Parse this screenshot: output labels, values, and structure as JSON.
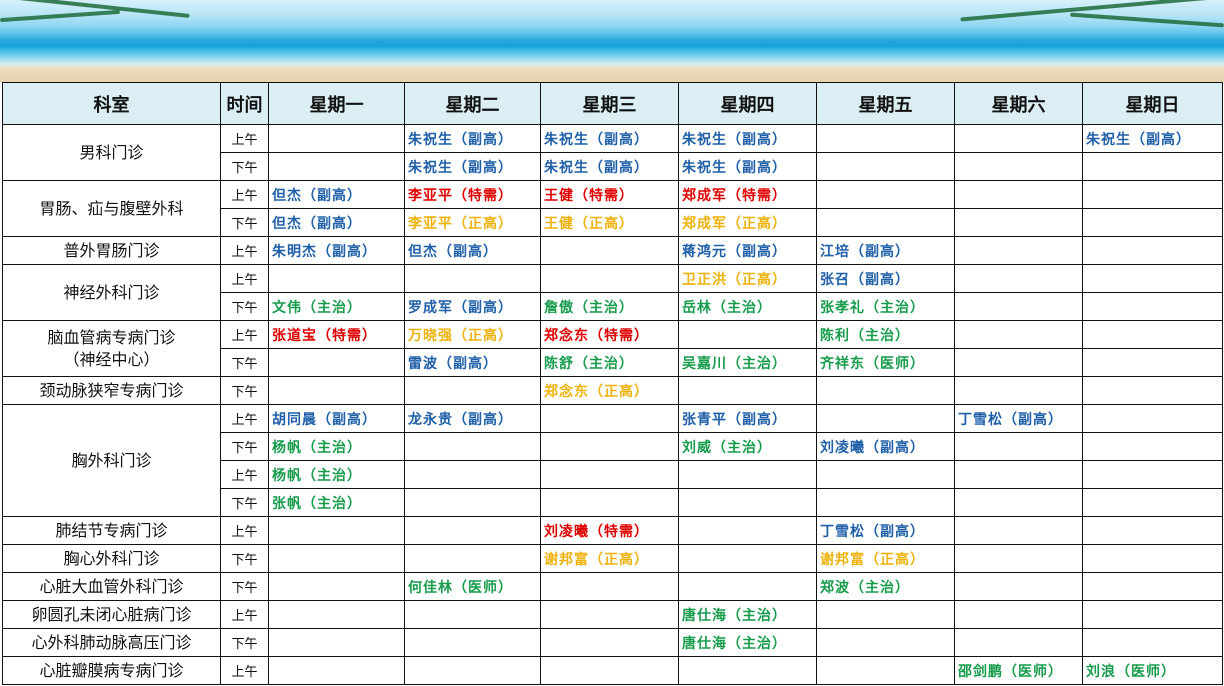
{
  "header": [
    "科室",
    "时间",
    "星期一",
    "星期二",
    "星期三",
    "星期四",
    "星期五",
    "星期六",
    "星期日"
  ],
  "colors": {
    "blue": "#1f5fa8",
    "red": "#e00000",
    "gold": "#eeb20a",
    "green": "#179c4c",
    "header_bg": "#daeef3"
  },
  "departments": [
    {
      "name": "男科门诊",
      "rows": [
        {
          "time": "上午",
          "cells": [
            "",
            {
              "t": "朱祝生（副高）",
              "c": "blue"
            },
            {
              "t": "朱祝生（副高）",
              "c": "blue"
            },
            {
              "t": "朱祝生（副高）",
              "c": "blue"
            },
            "",
            "",
            {
              "t": "朱祝生（副高）",
              "c": "blue"
            }
          ]
        },
        {
          "time": "下午",
          "cells": [
            "",
            {
              "t": "朱祝生（副高）",
              "c": "blue"
            },
            {
              "t": "朱祝生（副高）",
              "c": "blue"
            },
            {
              "t": "朱祝生（副高）",
              "c": "blue"
            },
            "",
            "",
            ""
          ]
        }
      ]
    },
    {
      "name": "胃肠、疝与腹壁外科",
      "rows": [
        {
          "time": "上午",
          "cells": [
            {
              "t": "但杰（副高）",
              "c": "blue"
            },
            {
              "t": "李亚平（特需）",
              "c": "red"
            },
            {
              "t": "王健（特需）",
              "c": "red"
            },
            {
              "t": "郑成军（特需）",
              "c": "red"
            },
            "",
            "",
            ""
          ]
        },
        {
          "time": "下午",
          "cells": [
            {
              "t": "但杰（副高）",
              "c": "blue"
            },
            {
              "t": "李亚平（正高）",
              "c": "gold"
            },
            {
              "t": "王健（正高）",
              "c": "gold"
            },
            {
              "t": "郑成军（正高）",
              "c": "gold"
            },
            "",
            "",
            ""
          ]
        }
      ]
    },
    {
      "name": "普外胃肠门诊",
      "rows": [
        {
          "time": "上午",
          "cells": [
            {
              "t": "朱明杰（副高）",
              "c": "blue"
            },
            {
              "t": "但杰（副高）",
              "c": "blue"
            },
            "",
            {
              "t": " 蒋鸿元（副高）",
              "c": "blue"
            },
            {
              "t": "江培（副高）",
              "c": "blue"
            },
            "",
            ""
          ]
        }
      ]
    },
    {
      "name": "神经外科门诊",
      "rows": [
        {
          "time": "上午",
          "cells": [
            "",
            "",
            "",
            {
              "t": "卫正洪（正高）",
              "c": "gold"
            },
            {
              "t": "张召（副高）",
              "c": "blue"
            },
            "",
            ""
          ]
        },
        {
          "time": "下午",
          "cells": [
            {
              "t": "文伟（主治）",
              "c": "green"
            },
            {
              "t": "罗成军（副高）",
              "c": "blue"
            },
            {
              "t": "詹傲（主治）",
              "c": "green"
            },
            {
              "t": "岳林（主治）",
              "c": "green"
            },
            {
              "t": "张孝礼（主治）",
              "c": "green"
            },
            "",
            ""
          ]
        }
      ]
    },
    {
      "name": "脑血管病专病门诊\n（神经中心）",
      "rows": [
        {
          "time": "上午",
          "cells": [
            {
              "t": "张道宝（特需）",
              "c": "red"
            },
            {
              "t": "万晓强（正高）",
              "c": "gold"
            },
            {
              "t": "郑念东（特需）",
              "c": "red"
            },
            "",
            {
              "t": "陈利（主治）",
              "c": "green"
            },
            "",
            ""
          ]
        },
        {
          "time": "下午",
          "cells": [
            "",
            {
              "t": "雷波（副高）",
              "c": "blue"
            },
            {
              "t": "陈舒（主治）",
              "c": "green"
            },
            {
              "t": "吴嘉川（主治）",
              "c": "green"
            },
            {
              "t": "齐祥东（医师）",
              "c": "green"
            },
            "",
            ""
          ]
        }
      ]
    },
    {
      "name": "颈动脉狭窄专病门诊",
      "rows": [
        {
          "time": "下午",
          "cells": [
            "",
            "",
            {
              "t": "郑念东（正高）",
              "c": "gold"
            },
            "",
            "",
            "",
            ""
          ]
        }
      ]
    },
    {
      "name": "胸外科门诊",
      "rows": [
        {
          "time": "上午",
          "cells": [
            {
              "t": "胡同晨（副高）",
              "c": "blue"
            },
            {
              "t": "龙永贵（副高）",
              "c": "blue"
            },
            "",
            {
              "t": "张青平（副高）",
              "c": "blue"
            },
            "",
            {
              "t": "丁雪松（副高）",
              "c": "blue"
            },
            ""
          ]
        },
        {
          "time": "下午",
          "cells": [
            {
              "t": "杨帆（主治）",
              "c": "green"
            },
            "",
            "",
            {
              "t": "刘威（主治）",
              "c": "green"
            },
            {
              "t": "刘凌曦（副高）",
              "c": "blue"
            },
            "",
            ""
          ]
        },
        {
          "time": "上午",
          "cells": [
            {
              "t": "杨帆（主治）",
              "c": "green"
            },
            "",
            "",
            "",
            "",
            "",
            ""
          ]
        },
        {
          "time": "下午",
          "cells": [
            {
              "t": "张帆（主治）",
              "c": "green"
            },
            "",
            "",
            "",
            "",
            "",
            ""
          ]
        }
      ]
    },
    {
      "name": "肺结节专病门诊",
      "rows": [
        {
          "time": "上午",
          "cells": [
            "",
            "",
            {
              "t": "刘凌曦（特需）",
              "c": "red"
            },
            "",
            {
              "t": "丁雪松（副高）",
              "c": "blue"
            },
            "",
            ""
          ]
        }
      ]
    },
    {
      "name": "胸心外科门诊",
      "rows": [
        {
          "time": "下午",
          "cells": [
            "",
            "",
            {
              "t": "谢邦富（正高）",
              "c": "gold"
            },
            "",
            {
              "t": "谢邦富（正高）",
              "c": "gold"
            },
            "",
            ""
          ]
        }
      ]
    },
    {
      "name": "心脏大血管外科门诊",
      "rows": [
        {
          "time": "下午",
          "cells": [
            "",
            {
              "t": "何佳林（医师）",
              "c": "green"
            },
            "",
            "",
            {
              "t": "郑波（主治）",
              "c": "green"
            },
            "",
            ""
          ]
        }
      ]
    },
    {
      "name": "卵圆孔未闭心脏病门诊",
      "rows": [
        {
          "time": "上午",
          "cells": [
            "",
            "",
            "",
            {
              "t": "唐仕海（主治）",
              "c": "green"
            },
            "",
            "",
            ""
          ]
        }
      ]
    },
    {
      "name": "心外科肺动脉高压门诊",
      "rows": [
        {
          "time": "下午",
          "cells": [
            "",
            "",
            "",
            {
              "t": "唐仕海（主治）",
              "c": "green"
            },
            "",
            "",
            ""
          ]
        }
      ]
    },
    {
      "name": "心脏瓣膜病专病门诊",
      "rows": [
        {
          "time": "上午",
          "cells": [
            "",
            "",
            "",
            "",
            "",
            {
              "t": "邵剑鹏（医师）",
              "c": "green"
            },
            {
              "t": "刘浪（医师）",
              "c": "green"
            }
          ]
        }
      ]
    }
  ]
}
